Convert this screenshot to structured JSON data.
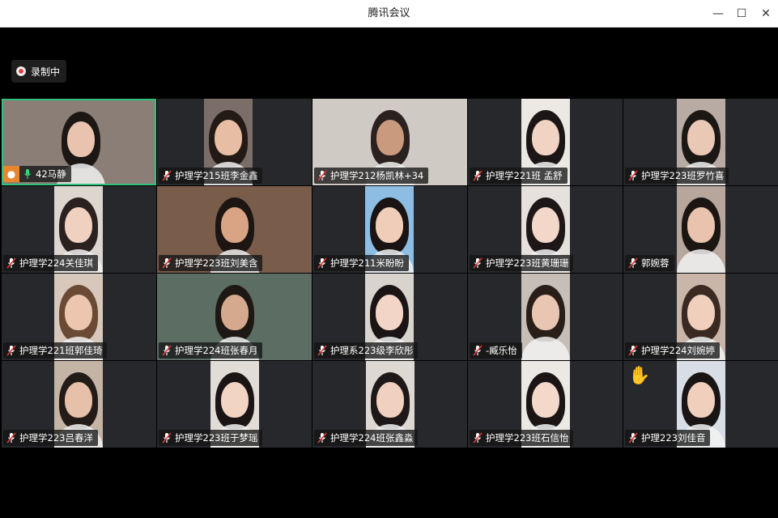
{
  "window": {
    "title": "腾讯会议",
    "minimize_icon": "—",
    "maximize_icon": "☐",
    "close_icon": "✕"
  },
  "recording": {
    "label": "录制中"
  },
  "participants": [
    {
      "name": "42马静",
      "muted": false,
      "active": true
    },
    {
      "name": "护理学215班李金鑫",
      "muted": true
    },
    {
      "name": "护理学212杨凯林+34",
      "muted": true
    },
    {
      "name": "护理学221班 孟舒",
      "muted": true
    },
    {
      "name": "护理学223班罗竹喜",
      "muted": true
    },
    {
      "name": "护理学224关佳琪",
      "muted": true
    },
    {
      "name": "护理学223班刘美含",
      "muted": true
    },
    {
      "name": "护理学211米盼盼",
      "muted": true
    },
    {
      "name": "护理学223班黄珊珊",
      "muted": true
    },
    {
      "name": "郭婉蓉",
      "muted": true
    },
    {
      "name": "护理学221班郭佳琦",
      "muted": true
    },
    {
      "name": "护理学224班张春月",
      "muted": true
    },
    {
      "name": "护理系223级李欣彤",
      "muted": true
    },
    {
      "name": "-臧乐怡",
      "muted": true
    },
    {
      "name": "护理学224刘婉婷",
      "muted": true
    },
    {
      "name": "护理学223吕春洋",
      "muted": true
    },
    {
      "name": "护理学223班于梦瑶",
      "muted": true
    },
    {
      "name": "护理学224班张鑫淼",
      "muted": true
    },
    {
      "name": "护理学223班石信怡",
      "muted": true
    },
    {
      "name": "护理223刘佳音",
      "muted": true,
      "raised_hand": true
    }
  ],
  "icons": {
    "mic_muted": "mic-muted-icon",
    "mic_on": "mic-on-icon",
    "raise_hand": "✋"
  },
  "colors": {
    "active_border": "#2ec27e",
    "record_dot": "#e23b3b",
    "tile_bg": "#26282b"
  }
}
